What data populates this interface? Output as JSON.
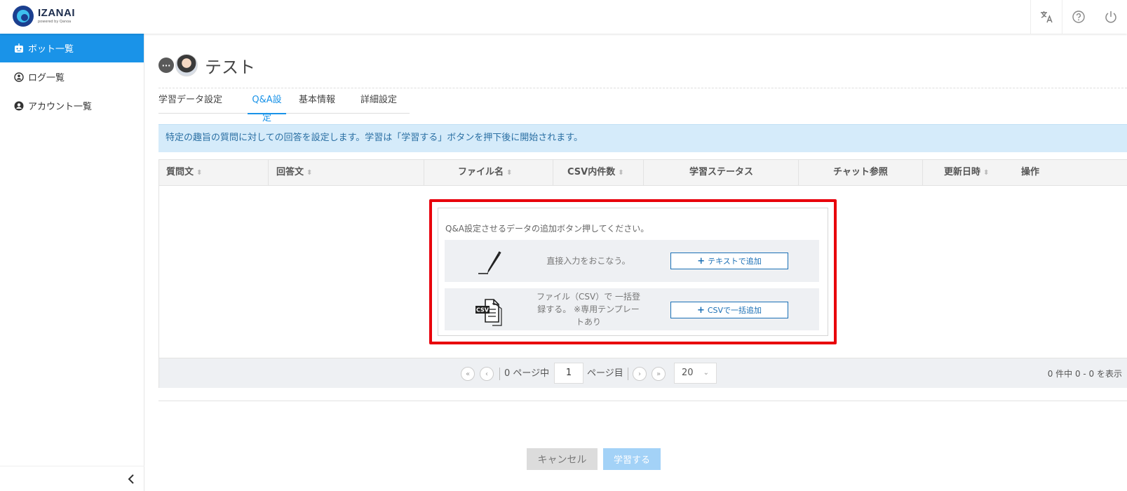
{
  "header": {
    "logo_name": "IZANAI",
    "logo_sub": "powered by Qanoa",
    "icons": [
      "translate-icon",
      "help-icon",
      "power-icon"
    ]
  },
  "sidebar": {
    "items": [
      {
        "label": "ボット一覧",
        "icon": "robot-icon",
        "active": true
      },
      {
        "label": "ログ一覧",
        "icon": "log-icon",
        "active": false
      },
      {
        "label": "アカウント一覧",
        "icon": "user-icon",
        "active": false
      }
    ],
    "collapse_icon": "chevron-left-icon"
  },
  "bot": {
    "bubble_glyph": "···",
    "name": "テスト"
  },
  "tabs": [
    {
      "label": "学習データ設定",
      "active": false
    },
    {
      "label": "Q&A設定",
      "active": true
    },
    {
      "label": "基本情報",
      "active": false
    },
    {
      "label": "詳細設定",
      "active": false
    }
  ],
  "info_text": "特定の趣旨の質問に対しての回答を設定します。学習は「学習する」ボタンを押下後に開始されます。",
  "table": {
    "columns": [
      {
        "label": "質問文",
        "sortable": true
      },
      {
        "label": "回答文",
        "sortable": true
      },
      {
        "label": "ファイル名",
        "sortable": true
      },
      {
        "label": "CSV内件数",
        "sortable": true
      },
      {
        "label": "学習ステータス",
        "sortable": false
      },
      {
        "label": "チャット参照",
        "sortable": false
      },
      {
        "label": "更新日時",
        "sortable": true
      },
      {
        "label": "操作",
        "sortable": false
      }
    ],
    "sort_glyph": "⬍"
  },
  "empty": {
    "message": "Q&A設定させるデータの追加ボタン押してください。",
    "options": [
      {
        "icon": "pen-icon",
        "text": "直接入力をおこなう。",
        "button": "テキストで追加"
      },
      {
        "icon": "csv-file-icon",
        "text": "ファイル（CSV）で 一括登録する。 ※専用テンプレートあり",
        "button": "CSVで一括追加"
      }
    ],
    "plus_glyph": "+"
  },
  "pager": {
    "first_glyph": "«",
    "prev_glyph": "‹",
    "next_glyph": "›",
    "last_glyph": "»",
    "pages_text": "0 ページ中",
    "current_page": "1",
    "page_suffix": "ページ目",
    "page_size": "20",
    "summary": "0 件中 0 - 0 を表示"
  },
  "footer": {
    "cancel": "キャンセル",
    "learn": "学習する"
  }
}
